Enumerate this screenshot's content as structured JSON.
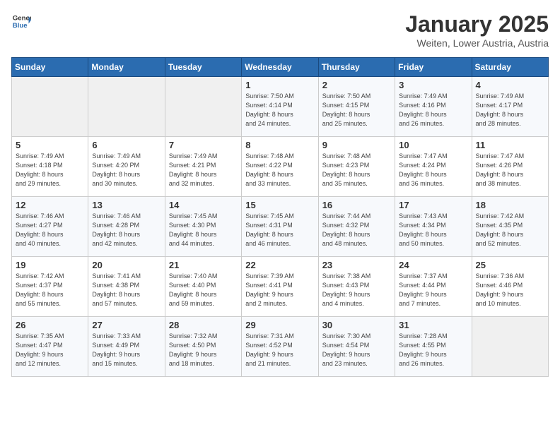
{
  "logo": {
    "general": "General",
    "blue": "Blue"
  },
  "header": {
    "title": "January 2025",
    "subtitle": "Weiten, Lower Austria, Austria"
  },
  "weekdays": [
    "Sunday",
    "Monday",
    "Tuesday",
    "Wednesday",
    "Thursday",
    "Friday",
    "Saturday"
  ],
  "weeks": [
    [
      {
        "day": "",
        "info": ""
      },
      {
        "day": "",
        "info": ""
      },
      {
        "day": "",
        "info": ""
      },
      {
        "day": "1",
        "info": "Sunrise: 7:50 AM\nSunset: 4:14 PM\nDaylight: 8 hours\nand 24 minutes."
      },
      {
        "day": "2",
        "info": "Sunrise: 7:50 AM\nSunset: 4:15 PM\nDaylight: 8 hours\nand 25 minutes."
      },
      {
        "day": "3",
        "info": "Sunrise: 7:49 AM\nSunset: 4:16 PM\nDaylight: 8 hours\nand 26 minutes."
      },
      {
        "day": "4",
        "info": "Sunrise: 7:49 AM\nSunset: 4:17 PM\nDaylight: 8 hours\nand 28 minutes."
      }
    ],
    [
      {
        "day": "5",
        "info": "Sunrise: 7:49 AM\nSunset: 4:18 PM\nDaylight: 8 hours\nand 29 minutes."
      },
      {
        "day": "6",
        "info": "Sunrise: 7:49 AM\nSunset: 4:20 PM\nDaylight: 8 hours\nand 30 minutes."
      },
      {
        "day": "7",
        "info": "Sunrise: 7:49 AM\nSunset: 4:21 PM\nDaylight: 8 hours\nand 32 minutes."
      },
      {
        "day": "8",
        "info": "Sunrise: 7:48 AM\nSunset: 4:22 PM\nDaylight: 8 hours\nand 33 minutes."
      },
      {
        "day": "9",
        "info": "Sunrise: 7:48 AM\nSunset: 4:23 PM\nDaylight: 8 hours\nand 35 minutes."
      },
      {
        "day": "10",
        "info": "Sunrise: 7:47 AM\nSunset: 4:24 PM\nDaylight: 8 hours\nand 36 minutes."
      },
      {
        "day": "11",
        "info": "Sunrise: 7:47 AM\nSunset: 4:26 PM\nDaylight: 8 hours\nand 38 minutes."
      }
    ],
    [
      {
        "day": "12",
        "info": "Sunrise: 7:46 AM\nSunset: 4:27 PM\nDaylight: 8 hours\nand 40 minutes."
      },
      {
        "day": "13",
        "info": "Sunrise: 7:46 AM\nSunset: 4:28 PM\nDaylight: 8 hours\nand 42 minutes."
      },
      {
        "day": "14",
        "info": "Sunrise: 7:45 AM\nSunset: 4:30 PM\nDaylight: 8 hours\nand 44 minutes."
      },
      {
        "day": "15",
        "info": "Sunrise: 7:45 AM\nSunset: 4:31 PM\nDaylight: 8 hours\nand 46 minutes."
      },
      {
        "day": "16",
        "info": "Sunrise: 7:44 AM\nSunset: 4:32 PM\nDaylight: 8 hours\nand 48 minutes."
      },
      {
        "day": "17",
        "info": "Sunrise: 7:43 AM\nSunset: 4:34 PM\nDaylight: 8 hours\nand 50 minutes."
      },
      {
        "day": "18",
        "info": "Sunrise: 7:42 AM\nSunset: 4:35 PM\nDaylight: 8 hours\nand 52 minutes."
      }
    ],
    [
      {
        "day": "19",
        "info": "Sunrise: 7:42 AM\nSunset: 4:37 PM\nDaylight: 8 hours\nand 55 minutes."
      },
      {
        "day": "20",
        "info": "Sunrise: 7:41 AM\nSunset: 4:38 PM\nDaylight: 8 hours\nand 57 minutes."
      },
      {
        "day": "21",
        "info": "Sunrise: 7:40 AM\nSunset: 4:40 PM\nDaylight: 8 hours\nand 59 minutes."
      },
      {
        "day": "22",
        "info": "Sunrise: 7:39 AM\nSunset: 4:41 PM\nDaylight: 9 hours\nand 2 minutes."
      },
      {
        "day": "23",
        "info": "Sunrise: 7:38 AM\nSunset: 4:43 PM\nDaylight: 9 hours\nand 4 minutes."
      },
      {
        "day": "24",
        "info": "Sunrise: 7:37 AM\nSunset: 4:44 PM\nDaylight: 9 hours\nand 7 minutes."
      },
      {
        "day": "25",
        "info": "Sunrise: 7:36 AM\nSunset: 4:46 PM\nDaylight: 9 hours\nand 10 minutes."
      }
    ],
    [
      {
        "day": "26",
        "info": "Sunrise: 7:35 AM\nSunset: 4:47 PM\nDaylight: 9 hours\nand 12 minutes."
      },
      {
        "day": "27",
        "info": "Sunrise: 7:33 AM\nSunset: 4:49 PM\nDaylight: 9 hours\nand 15 minutes."
      },
      {
        "day": "28",
        "info": "Sunrise: 7:32 AM\nSunset: 4:50 PM\nDaylight: 9 hours\nand 18 minutes."
      },
      {
        "day": "29",
        "info": "Sunrise: 7:31 AM\nSunset: 4:52 PM\nDaylight: 9 hours\nand 21 minutes."
      },
      {
        "day": "30",
        "info": "Sunrise: 7:30 AM\nSunset: 4:54 PM\nDaylight: 9 hours\nand 23 minutes."
      },
      {
        "day": "31",
        "info": "Sunrise: 7:28 AM\nSunset: 4:55 PM\nDaylight: 9 hours\nand 26 minutes."
      },
      {
        "day": "",
        "info": ""
      }
    ]
  ]
}
